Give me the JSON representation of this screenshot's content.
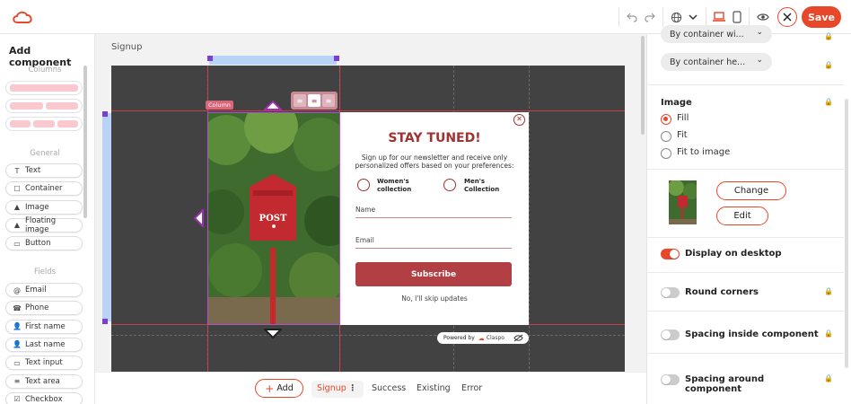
{
  "app": {
    "brand_color": "#e8472a",
    "logo_icon": "cloud-logo-icon"
  },
  "toolbar": {
    "undo_icon": "undo-icon",
    "redo_icon": "redo-icon",
    "language_icon": "globe-icon",
    "desktop_icon": "laptop-icon",
    "mobile_icon": "phone-icon",
    "preview_icon": "eye-icon",
    "close_icon": "close-icon",
    "save_label": "Save"
  },
  "left_panel": {
    "title": "Add component",
    "columns_section": "Columns",
    "general_section": "General",
    "general_items": [
      {
        "label": "Text",
        "icon": "T"
      },
      {
        "label": "Container",
        "icon": "☐"
      },
      {
        "label": "Image",
        "icon": "▲"
      },
      {
        "label": "Floating image",
        "icon": "▲"
      },
      {
        "label": "Button",
        "icon": "▭"
      }
    ],
    "fields_section": "Fields",
    "field_items": [
      {
        "label": "Email",
        "icon": "@"
      },
      {
        "label": "Phone",
        "icon": "☎"
      },
      {
        "label": "First name",
        "icon": "👤"
      },
      {
        "label": "Last name",
        "icon": "👤"
      },
      {
        "label": "Text input",
        "icon": "▭"
      },
      {
        "label": "Text area",
        "icon": "≡"
      },
      {
        "label": "Checkbox",
        "icon": "☑"
      }
    ]
  },
  "canvas": {
    "page_label": "Signup",
    "column_label": "Column",
    "popup": {
      "title": "STAY TUNED!",
      "subtitle": "Sign up for our newsletter and receive only personalized offers based on your preferences:",
      "option_1": "Women's collection",
      "option_2": "Men's Collection",
      "name_placeholder": "Name",
      "email_placeholder": "Email",
      "subscribe_label": "Subscribe",
      "skip_label": "No, I'll skip updates",
      "powered_by": "Powered by",
      "powered_brand": "Claspo",
      "mailbox_text": "POST"
    }
  },
  "bottom_bar": {
    "add_label": "Add",
    "tabs": [
      "Signup",
      "Success",
      "Existing",
      "Error"
    ],
    "active_tab": "Signup"
  },
  "right_panel": {
    "dropdown_1": "By container wi...",
    "dropdown_2": "By container he...",
    "image_heading": "Image",
    "image_options": [
      "Fill",
      "Fit",
      "Fit to image"
    ],
    "image_selected": "Fill",
    "change_label": "Change",
    "edit_label": "Edit",
    "toggles": [
      {
        "label": "Display on desktop",
        "on": true
      },
      {
        "label": "Round corners",
        "on": false
      },
      {
        "label": "Spacing inside component",
        "on": false
      },
      {
        "label": "Spacing around component",
        "on": false
      }
    ]
  }
}
